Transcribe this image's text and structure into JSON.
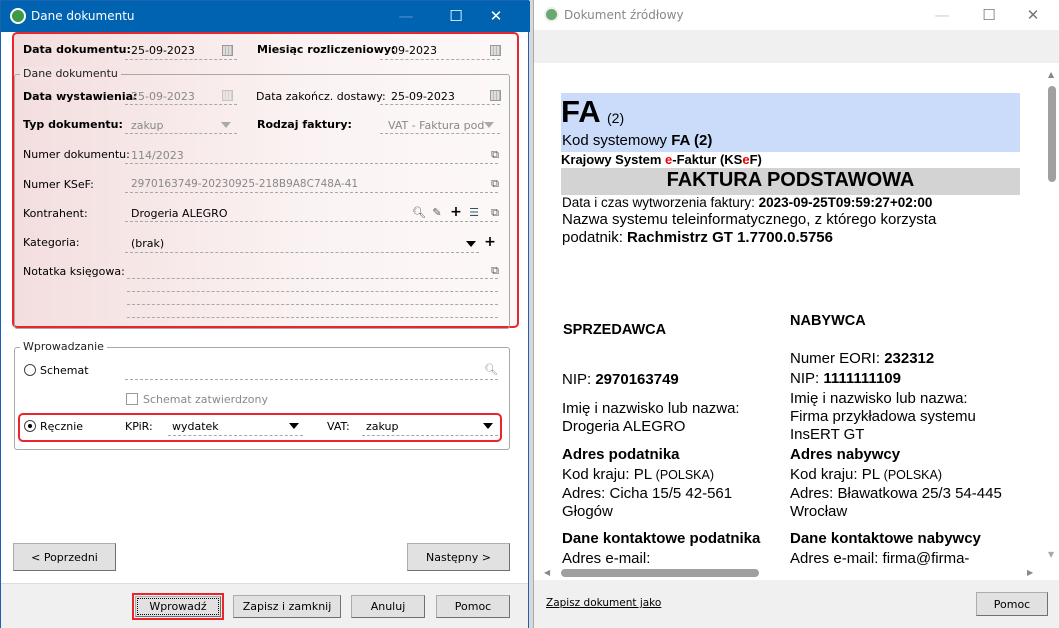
{
  "left_window": {
    "title": "Dane dokumentu",
    "data_dokumentu": {
      "label": "Data dokumentu:",
      "value": "25-09-2023"
    },
    "miesiac": {
      "label": "Miesiąc rozliczeniowy:",
      "value": "09-2023"
    },
    "group1_title": "Dane dokumentu",
    "data_wystawienia": {
      "label": "Data wystawienia:",
      "value": "25-09-2023"
    },
    "data_dostawy": {
      "label": "Data zakończ. dostawy:",
      "value": "25-09-2023"
    },
    "typ": {
      "label": "Typ dokumentu:",
      "value": "zakup"
    },
    "rodzaj": {
      "label": "Rodzaj faktury:",
      "value": "VAT - Faktura podsta"
    },
    "numer": {
      "label": "Numer dokumentu:",
      "value": "114/2023"
    },
    "ksef": {
      "label": "Numer KSeF:",
      "value": "2970163749-20230925-218B9A8C748A-41"
    },
    "kontrahent": {
      "label": "Kontrahent:",
      "value": "Drogeria ALEGRO"
    },
    "kategoria": {
      "label": "Kategoria:",
      "value": "(brak)"
    },
    "notatka": {
      "label": "Notatka księgowa:",
      "value": ""
    },
    "group2_title": "Wprowadzanie",
    "schemat": {
      "label": "Schemat",
      "selected": false
    },
    "schemat_zatwierdzony": {
      "label": "Schemat zatwierdzony",
      "checked": false
    },
    "recznie": {
      "label": "Ręcznie",
      "selected": true
    },
    "kpir": {
      "label": "KPiR:",
      "value": "wydatek"
    },
    "vat": {
      "label": "VAT:",
      "value": "zakup"
    },
    "buttons": {
      "prev": "<  Poprzedni",
      "next": "Następny  >",
      "wprowadz": "Wprowadź",
      "zapisz": "Zapisz i zamknij",
      "anuluj": "Anuluj",
      "pomoc": "Pomoc"
    },
    "highlight_color": "#e8262c"
  },
  "right_window": {
    "title": "Dokument źródłowy",
    "doc": {
      "fa": "FA",
      "fa_ver": "(2)",
      "kod_label": "Kod systemowy ",
      "kod_value": "FA (2)",
      "ksef_a": "Krajowy System ",
      "ksef_e": "e",
      "ksef_b": "-Faktur (KS",
      "ksef_e2": "e",
      "ksef_c": "F)",
      "heading": "FAKTURA PODSTAWOWA",
      "data_label": "Data i czas wytworzenia faktury: ",
      "data_value": "2023-09-25T09:59:27+02:00",
      "system_label1": "Nazwa systemu teleinformatycznego, z którego korzysta",
      "system_label2": "podatnik: ",
      "system_value": "Rachmistrz GT 1.7700.0.5756",
      "seller": {
        "title": "SPRZEDAWCA",
        "nip_label": "NIP: ",
        "nip": "2970163749",
        "name_label": "Imię i nazwisko lub nazwa:",
        "name": "Drogeria ALEGRO",
        "addr_title": "Adres podatnika",
        "kod_label": "Kod kraju: PL ",
        "kod_country": "(POLSKA)",
        "addr1": "Adres: Cicha 15/5 42-561",
        "addr2": "Głogów",
        "contact_title": "Dane kontaktowe podatnika",
        "email": "Adres e-mail:"
      },
      "buyer": {
        "title": "NABYWCA",
        "eori_label": "Numer EORI: ",
        "eori": "232312",
        "nip_label": "NIP: ",
        "nip": "1111111109",
        "name_label": "Imię i nazwisko lub nazwa:",
        "name1": "Firma przykładowa systemu",
        "name2": "InsERT GT",
        "addr_title": "Adres nabywcy",
        "kod_label": "Kod kraju: PL ",
        "kod_country": "(POLSKA)",
        "addr1": "Adres: Bławatkowa 25/3 54-445",
        "addr2": "Wrocław",
        "contact_title": "Dane kontaktowe nabywcy",
        "email": "Adres e-mail: firma@firma-"
      }
    },
    "save_link": "Zapisz dokument jako",
    "pomoc": "Pomoc"
  }
}
